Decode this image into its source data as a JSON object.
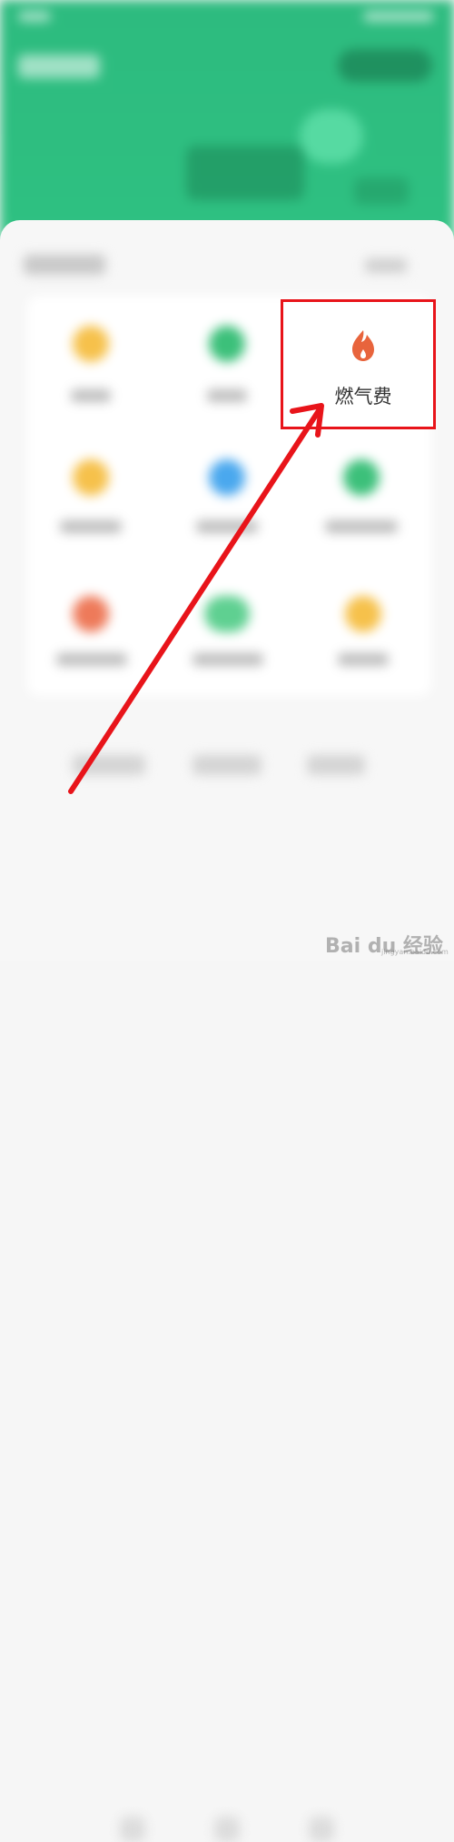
{
  "gas_service": {
    "label": "燃气费",
    "icon": "flame-icon",
    "icon_color": "#e8643c"
  },
  "annotation": {
    "highlight_color": "#e8141a",
    "arrow_color": "#e8141a"
  },
  "theme": {
    "header_color": "#2ebf80",
    "page_background": "#f6f6f6"
  },
  "watermark": {
    "text": "Bai du 经验",
    "subtext": "jingyan.baidu.com"
  }
}
